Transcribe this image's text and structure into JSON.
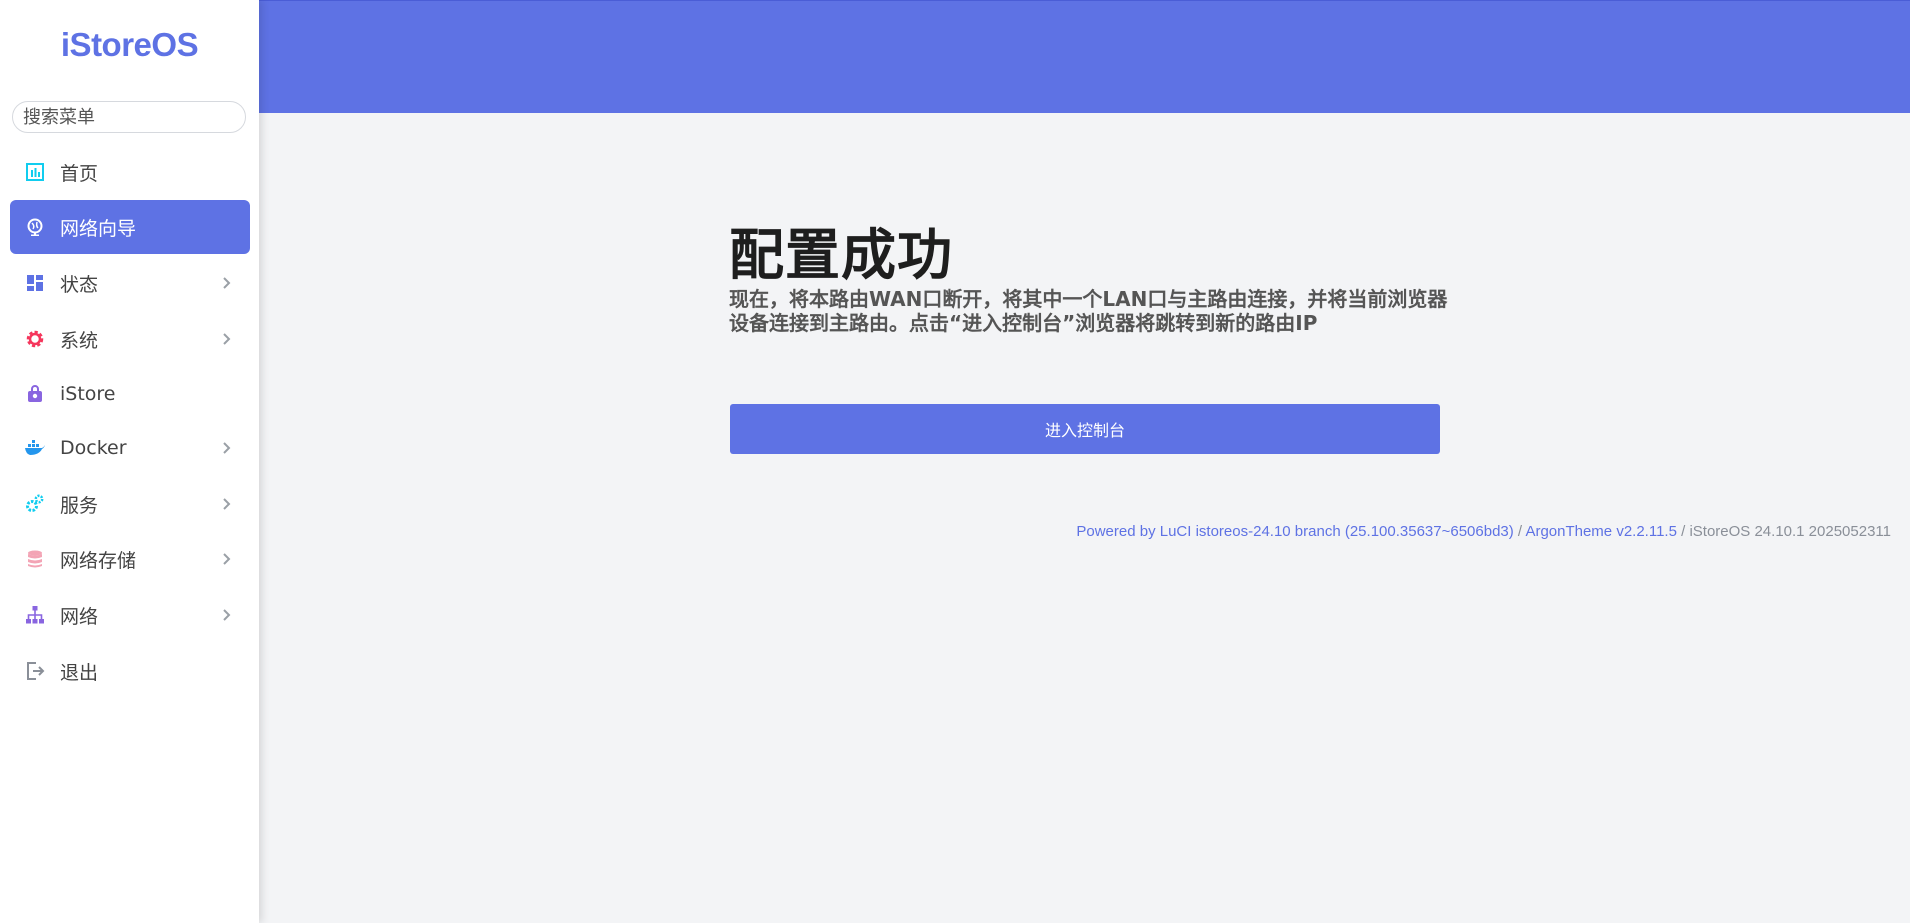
{
  "brand": "iStoreOS",
  "search": {
    "placeholder": "搜索菜单"
  },
  "sidebar": {
    "items": [
      {
        "label": "首页",
        "icon": "dashboard-icon"
      },
      {
        "label": "网络向导",
        "icon": "globe-icon",
        "active": true
      },
      {
        "label": "状态",
        "icon": "grid-icon"
      },
      {
        "label": "系统",
        "icon": "gear-icon"
      },
      {
        "label": "iStore",
        "icon": "store-bag-icon"
      },
      {
        "label": "Docker",
        "icon": "docker-icon"
      },
      {
        "label": "服务",
        "icon": "cogs-icon"
      },
      {
        "label": "网络存储",
        "icon": "database-icon"
      },
      {
        "label": "网络",
        "icon": "network-icon"
      },
      {
        "label": "退出",
        "icon": "logout-icon"
      }
    ]
  },
  "main": {
    "title": "配置成功",
    "description": "现在，将本路由WAN口断开，将其中一个LAN口与主路由连接，并将当前浏览器设备连接到主路由。点击“进入控制台”浏览器将跳转到新的路由IP",
    "button_label": "进入控制台"
  },
  "footer": {
    "luci_link": "Powered by LuCI istoreos-24.10 branch (25.100.35637~6506bd3)",
    "separator": "/",
    "theme_link": "ArgonTheme v2.2.11.5",
    "version": "iStoreOS 24.10.1 2025052311"
  },
  "colors": {
    "accent": "#5e72e4",
    "background": "#f3f4f6"
  }
}
